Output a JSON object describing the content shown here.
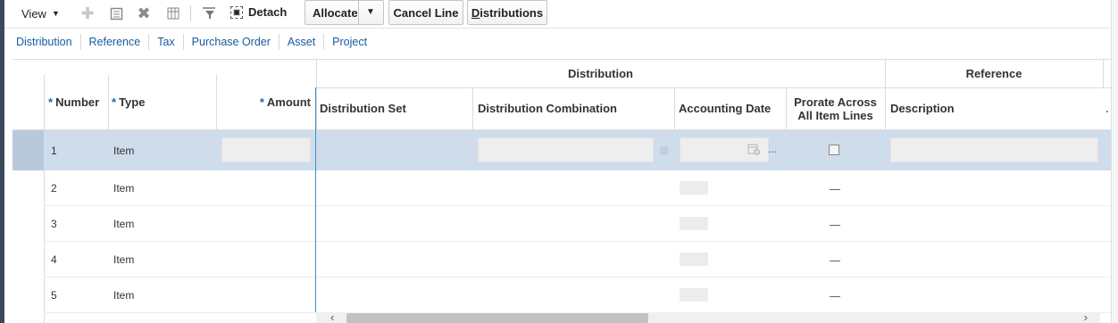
{
  "toolbar": {
    "view_label": "View",
    "detach_label": "Detach",
    "allocate_label": "Allocate",
    "cancel_line_label": "Cancel Line",
    "distributions_prefix": "D",
    "distributions_rest": "istributions"
  },
  "tabs": [
    "Distribution",
    "Reference",
    "Tax",
    "Purchase Order",
    "Asset",
    "Project"
  ],
  "table": {
    "group_headers": {
      "distribution": "Distribution",
      "reference": "Reference"
    },
    "required_mark": "*",
    "columns": {
      "number": "Number",
      "type": "Type",
      "amount": "Amount",
      "distribution_set": "Distribution Set",
      "distribution_combination": "Distribution Combination",
      "accounting_date": "Accounting Date",
      "prorate_line1": "Prorate Across",
      "prorate_line2": "All Item Lines",
      "description": "Description",
      "more": "."
    },
    "rows": [
      {
        "number": "1",
        "type": "Item"
      },
      {
        "number": "2",
        "type": "Item"
      },
      {
        "number": "3",
        "type": "Item"
      },
      {
        "number": "4",
        "type": "Item"
      },
      {
        "number": "5",
        "type": "Item"
      }
    ],
    "ellipsis": "..."
  },
  "icons": [
    "add-icon",
    "edit-icon",
    "delete-icon",
    "freeze-icon",
    "query-by-example-icon",
    "detach-icon",
    "calendar-icon",
    "search-icon",
    "dropdown-arrow-icon"
  ],
  "colors": {
    "link": "#145c9e",
    "selected_row": "#cfdcec",
    "required": "#1a6cb0",
    "frozen_divider": "#3a8fc6"
  }
}
